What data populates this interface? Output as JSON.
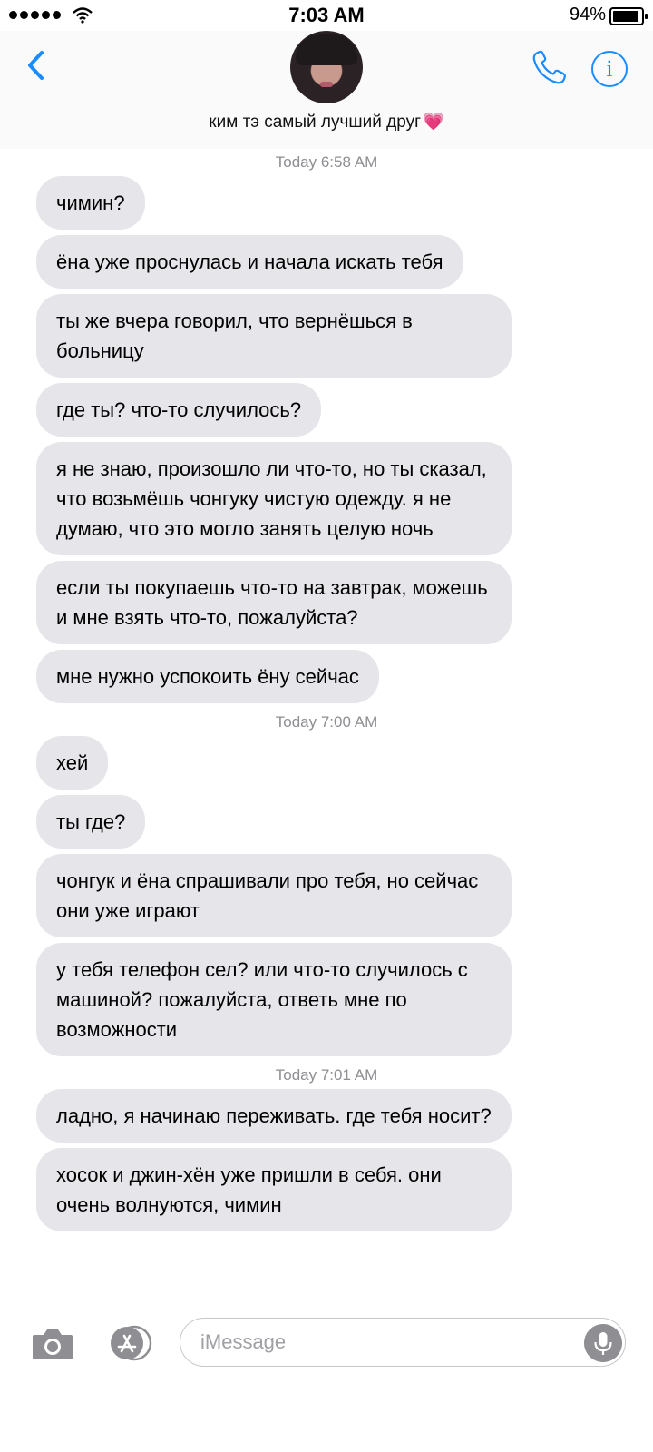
{
  "status_bar": {
    "time": "7:03 AM",
    "battery_percent": "94%"
  },
  "header": {
    "contact_name": "ким тэ самый лучший друг",
    "heart_emoji": "💗"
  },
  "thread": {
    "groups": [
      {
        "timestamp": "Today 6:58 AM",
        "messages": [
          "чимин?",
          "ёна уже проснулась и начала искать тебя",
          "ты же вчера говорил, что вернёшься в больницу",
          "где ты? что-то случилось?",
          "я не знаю, произошло ли что-то, но ты сказал, что возьмёшь чонгуку чистую одежду. я не думаю, что это могло занять целую ночь",
          "если ты покупаешь что-то на завтрак, можешь и мне взять что-то, пожалуйста?",
          "мне нужно успокоить ёну сейчас"
        ]
      },
      {
        "timestamp": "Today 7:00 AM",
        "messages": [
          "хей",
          "ты где?",
          "чонгук и ёна спрашивали про тебя, но сейчас они уже играют",
          "у тебя телефон сел? или что-то случилось с машиной? пожалуйста, ответь мне по возможности"
        ]
      },
      {
        "timestamp": "Today 7:01 AM",
        "messages": [
          "ладно, я начинаю переживать. где тебя носит?",
          "хосок и джин-хён уже пришли в себя. они очень волнуются, чимин"
        ]
      }
    ]
  },
  "input_bar": {
    "placeholder": "iMessage"
  },
  "colors": {
    "accent": "#1a8cff",
    "bubble_incoming": "#e5e5ea",
    "timestamp": "#8e8e93"
  },
  "icons": {
    "back": "chevron-left-icon",
    "call": "phone-icon",
    "info": "info-icon",
    "camera": "camera-icon",
    "apps": "app-store-icon",
    "mic": "microphone-icon"
  }
}
